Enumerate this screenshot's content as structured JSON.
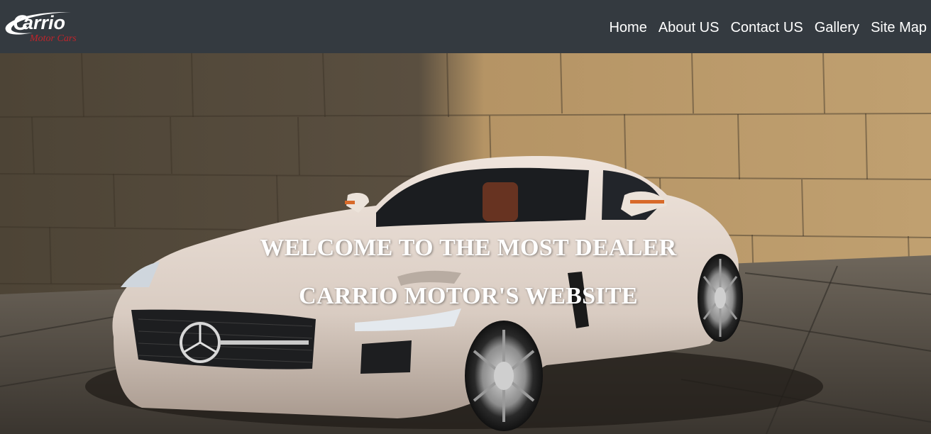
{
  "brand": {
    "logo_main": "arrio",
    "logo_initial": "C",
    "logo_script": "Motor Cars",
    "colors": {
      "navbar": "#343a40",
      "logo_red": "#c0242b",
      "text": "#ffffff"
    }
  },
  "nav": {
    "items": [
      {
        "label": "Home"
      },
      {
        "label": "About US"
      },
      {
        "label": "Contact US"
      },
      {
        "label": "Gallery"
      },
      {
        "label": "Site Map"
      }
    ]
  },
  "hero": {
    "line1": "WELCOME TO THE MOST DEALER",
    "line2": "CARRIO MOTOR'S WEBSITE",
    "image_subject": "white-sports-car-photo"
  }
}
